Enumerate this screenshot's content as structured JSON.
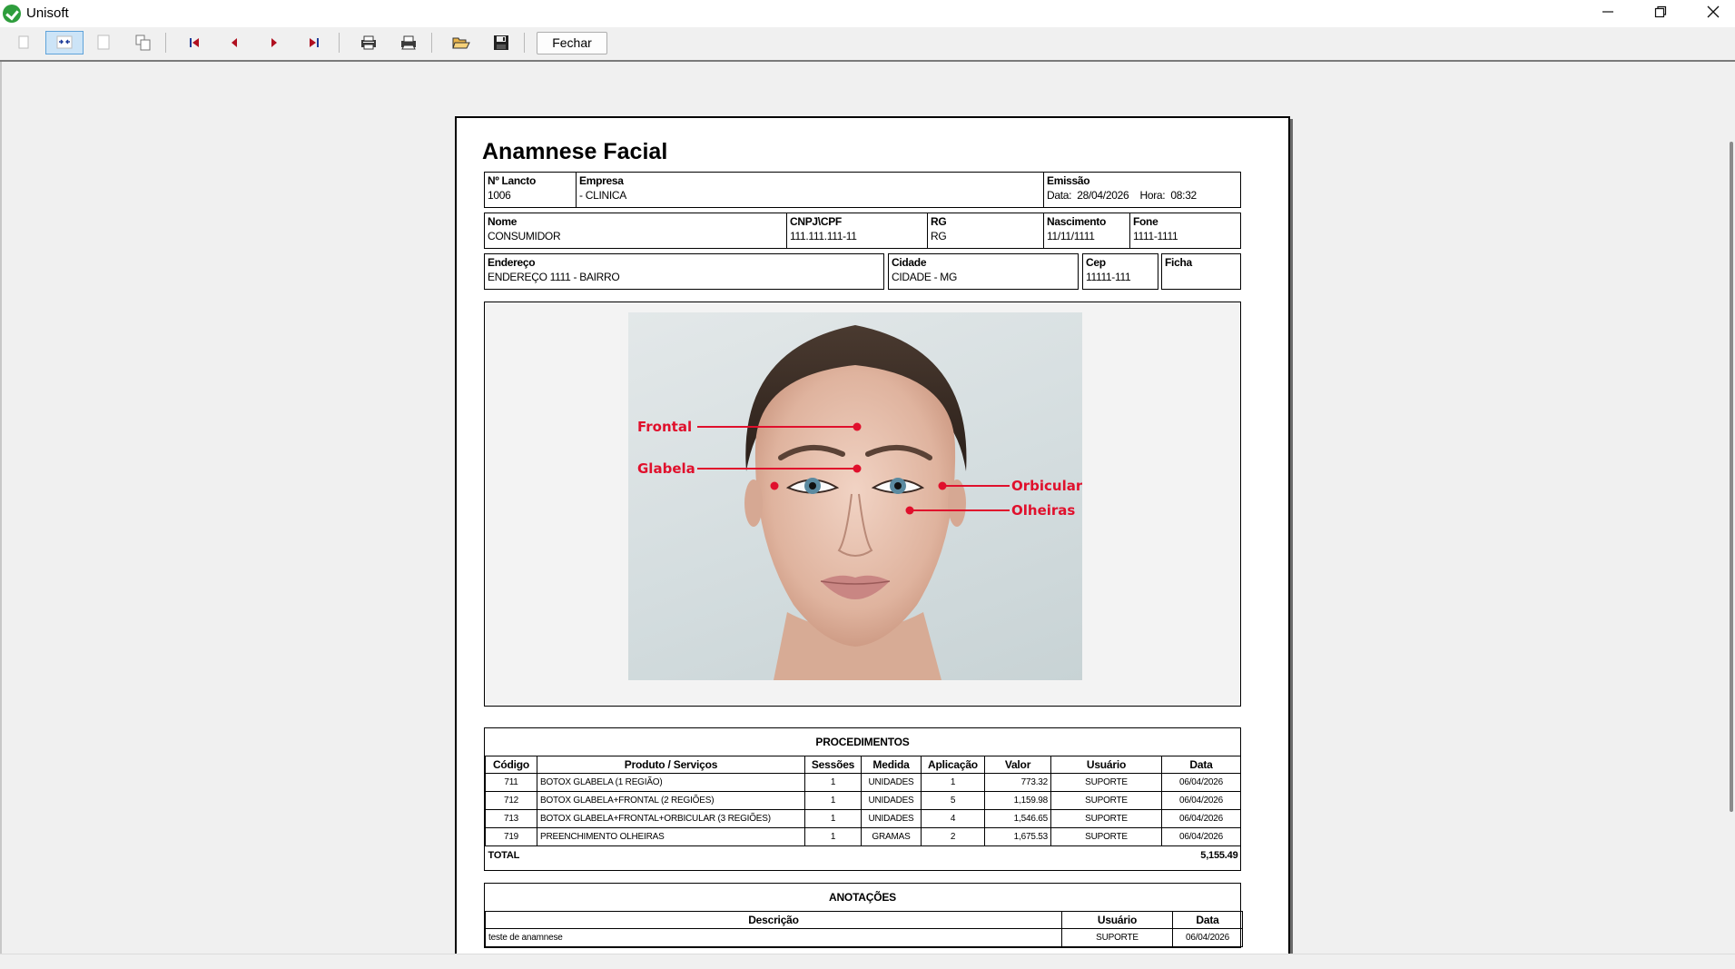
{
  "window": {
    "title": "Unisoft"
  },
  "toolbar": {
    "close_label": "Fechar"
  },
  "report": {
    "title": "Anamnese Facial",
    "header": {
      "lancto_label": "Nº Lancto",
      "lancto": "1006",
      "empresa_label": "Empresa",
      "empresa": "- CLINICA",
      "emissao_label": "Emissão",
      "data_label": "Data:",
      "data": "28/04/2026",
      "hora_label": "Hora:",
      "hora": "08:32"
    },
    "client": {
      "nome_label": "Nome",
      "nome": "CONSUMIDOR",
      "cnpj_label": "CNPJ\\CPF",
      "cnpj": "111.111.111-11",
      "rg_label": "RG",
      "rg": "RG",
      "nascimento_label": "Nascimento",
      "nascimento": "11/11/1111",
      "fone_label": "Fone",
      "fone": "1111-1111"
    },
    "address": {
      "endereco_label": "Endereço",
      "endereco": "ENDEREÇO 1111 - BAIRRO",
      "cidade_label": "Cidade",
      "cidade": "CIDADE - MG",
      "cep_label": "Cep",
      "cep": "11111-111",
      "ficha_label": "Ficha"
    },
    "face_markers": {
      "frontal": "Frontal",
      "glabela": "Glabela",
      "orbicular": "Orbicular",
      "olheiras": "Olheiras"
    },
    "procedimentos": {
      "title": "PROCEDIMENTOS",
      "columns": [
        "Código",
        "Produto / Serviços",
        "Sessões",
        "Medida",
        "Aplicação",
        "Valor",
        "Usuário",
        "Data"
      ],
      "rows": [
        [
          "711",
          "BOTOX GLABELA (1 REGIÃO)",
          "1",
          "UNIDADES",
          "1",
          "773.32",
          "SUPORTE",
          "06/04/2026"
        ],
        [
          "712",
          "BOTOX GLABELA+FRONTAL (2 REGIÕES)",
          "1",
          "UNIDADES",
          "5",
          "1,159.98",
          "SUPORTE",
          "06/04/2026"
        ],
        [
          "713",
          "BOTOX GLABELA+FRONTAL+ORBICULAR (3 REGIÕES)",
          "1",
          "UNIDADES",
          "4",
          "1,546.65",
          "SUPORTE",
          "06/04/2026"
        ],
        [
          "719",
          "PREENCHIMENTO OLHEIRAS",
          "1",
          "GRAMAS",
          "2",
          "1,675.53",
          "SUPORTE",
          "06/04/2026"
        ]
      ],
      "total_label": "TOTAL",
      "total_value": "5,155.49"
    },
    "anotacoes": {
      "title": "ANOTAÇÕES",
      "columns": [
        "Descrição",
        "Usuário",
        "Data"
      ],
      "rows": [
        [
          "teste de anamnese",
          "SUPORTE",
          "06/04/2026"
        ]
      ]
    }
  }
}
